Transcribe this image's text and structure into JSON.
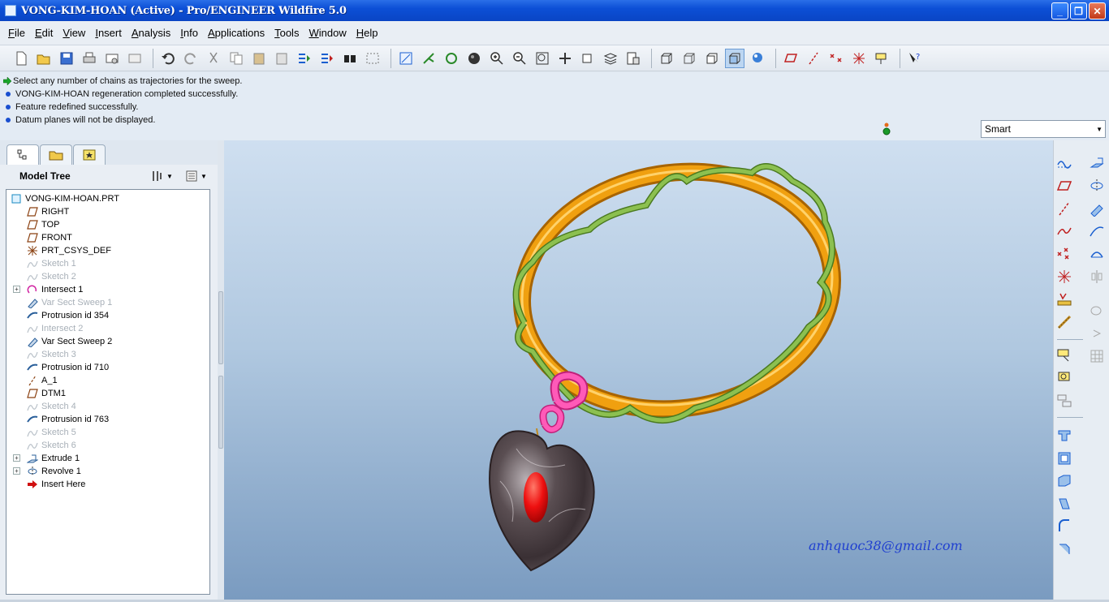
{
  "window": {
    "title": "VONG-KIM-HOAN (Active) - Pro/ENGINEER Wildfire 5.0",
    "controls": [
      "minimize",
      "restore",
      "close"
    ]
  },
  "menu": {
    "items": [
      {
        "label": "File"
      },
      {
        "label": "Edit"
      },
      {
        "label": "View"
      },
      {
        "label": "Insert"
      },
      {
        "label": "Analysis"
      },
      {
        "label": "Info"
      },
      {
        "label": "Applications"
      },
      {
        "label": "Tools"
      },
      {
        "label": "Window"
      },
      {
        "label": "Help"
      }
    ]
  },
  "messages": [
    {
      "type": "prompt",
      "text": "Select any number of chains as trajectories for the sweep."
    },
    {
      "type": "info",
      "text": "VONG-KIM-HOAN regeneration completed successfully."
    },
    {
      "type": "info",
      "text": "Feature redefined successfully."
    },
    {
      "type": "info",
      "text": "Datum planes will not be displayed."
    }
  ],
  "filter": {
    "selected": "Smart"
  },
  "model_tree": {
    "title": "Model Tree",
    "root": "VONG-KIM-HOAN.PRT",
    "items": [
      {
        "label": "RIGHT",
        "icon": "datum-plane-icon",
        "dim": false,
        "expandable": false
      },
      {
        "label": "TOP",
        "icon": "datum-plane-icon",
        "dim": false,
        "expandable": false
      },
      {
        "label": "FRONT",
        "icon": "datum-plane-icon",
        "dim": false,
        "expandable": false
      },
      {
        "label": "PRT_CSYS_DEF",
        "icon": "csys-icon",
        "dim": false,
        "expandable": false
      },
      {
        "label": "Sketch 1",
        "icon": "sketch-icon",
        "dim": true,
        "expandable": false
      },
      {
        "label": "Sketch 2",
        "icon": "sketch-icon",
        "dim": true,
        "expandable": false
      },
      {
        "label": "Intersect 1",
        "icon": "intersect-icon",
        "dim": false,
        "expandable": true
      },
      {
        "label": "Var Sect Sweep 1",
        "icon": "sweep-icon",
        "dim": true,
        "expandable": false
      },
      {
        "label": "Protrusion id 354",
        "icon": "protrusion-icon",
        "dim": false,
        "expandable": false
      },
      {
        "label": "Intersect 2",
        "icon": "sketch-icon",
        "dim": true,
        "expandable": false
      },
      {
        "label": "Var Sect Sweep 2",
        "icon": "sweep-icon",
        "dim": false,
        "expandable": false
      },
      {
        "label": "Sketch 3",
        "icon": "sketch-icon",
        "dim": true,
        "expandable": false
      },
      {
        "label": "Protrusion id 710",
        "icon": "protrusion-icon",
        "dim": false,
        "expandable": false
      },
      {
        "label": "A_1",
        "icon": "axis-icon",
        "dim": false,
        "expandable": false
      },
      {
        "label": "DTM1",
        "icon": "datum-plane-icon",
        "dim": false,
        "expandable": false
      },
      {
        "label": "Sketch 4",
        "icon": "sketch-icon",
        "dim": true,
        "expandable": false
      },
      {
        "label": "Protrusion id 763",
        "icon": "protrusion-icon",
        "dim": false,
        "expandable": false
      },
      {
        "label": "Sketch 5",
        "icon": "sketch-icon",
        "dim": true,
        "expandable": false
      },
      {
        "label": "Sketch 6",
        "icon": "sketch-icon",
        "dim": true,
        "expandable": false
      },
      {
        "label": "Extrude 1",
        "icon": "extrude-icon",
        "dim": false,
        "expandable": true
      },
      {
        "label": "Revolve 1",
        "icon": "revolve-icon",
        "dim": false,
        "expandable": true
      },
      {
        "label": "Insert Here",
        "icon": "insert-here-icon",
        "dim": false,
        "expandable": false
      }
    ]
  },
  "viewport": {
    "watermark": "anhquoc38@gmail.com",
    "colors": {
      "ring": "#f0a010",
      "vine": "#78b040",
      "link": "#ff5ab8",
      "gem": "#ee1010",
      "stone": "#5a4e52"
    }
  }
}
